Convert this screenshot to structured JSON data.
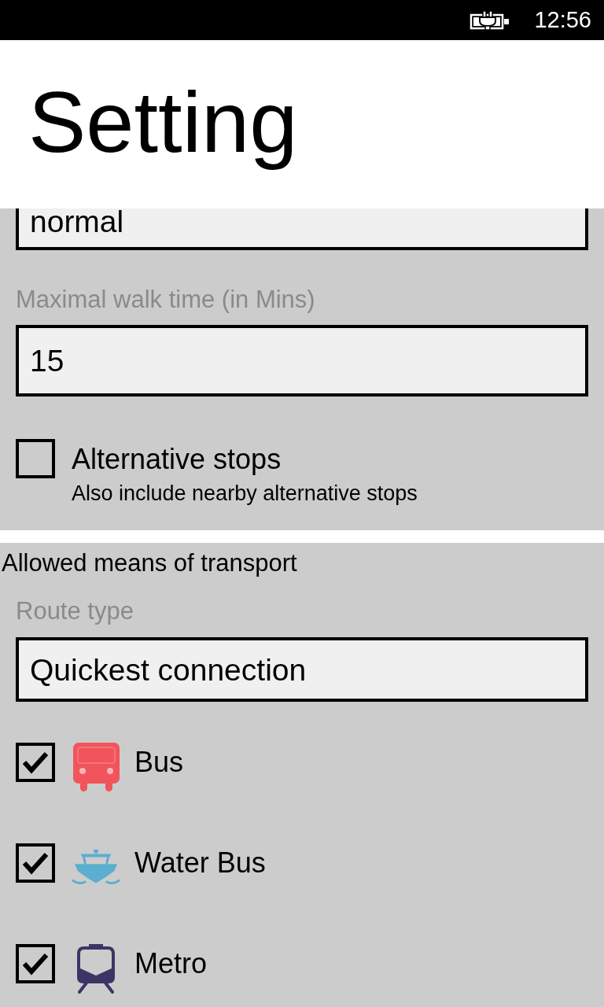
{
  "status_bar": {
    "time": "12:56"
  },
  "header": {
    "title": "Setting"
  },
  "walking": {
    "picker_value": "normal",
    "walk_time": {
      "label": "Maximal walk time (in Mins)",
      "value": "15"
    },
    "alternative_stops": {
      "label": "Alternative stops",
      "description": "Also include nearby alternative stops",
      "checked": false
    }
  },
  "transport": {
    "title": "Allowed means of transport",
    "route_type": {
      "label": "Route type",
      "value": "Quickest connection"
    },
    "means": [
      {
        "kind": "bus",
        "label": "Bus",
        "checked": true
      },
      {
        "kind": "water_bus",
        "label": "Water Bus",
        "checked": true
      },
      {
        "kind": "metro",
        "label": "Metro",
        "checked": true
      }
    ]
  }
}
